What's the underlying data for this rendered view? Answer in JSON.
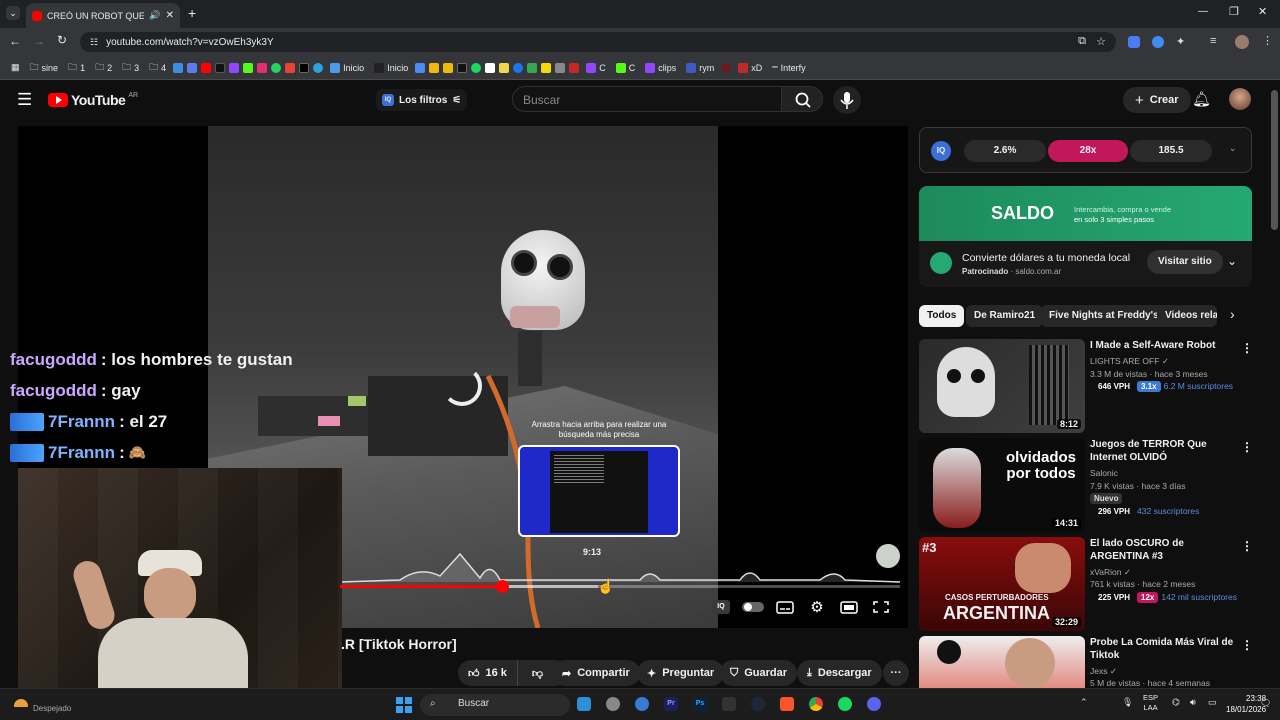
{
  "browser": {
    "tab_title": "CREÓ UN ROBOT QUE GAN",
    "url": "youtube.com/watch?v=vzOwEh3yk3Y",
    "bookmarks": [
      "sine",
      "1",
      "2",
      "3",
      "4",
      "Inicio",
      "Inicio",
      "C",
      "C",
      "clips",
      "rym",
      "xD",
      "Interfy"
    ]
  },
  "youtube": {
    "logo_text": "YouTube",
    "country": "AR",
    "filters_label": "Los filtros",
    "search_placeholder": "Buscar",
    "create_label": "Crear"
  },
  "player": {
    "chat": [
      {
        "user": "facugoddd",
        "msg": ": los hombres te gustan",
        "color": "#c9a8ff"
      },
      {
        "user": "facugoddd",
        "msg": ": gay",
        "color": "#c9a8ff"
      },
      {
        "user": "7Frannn",
        "msg": ": el 27",
        "color": "#7fb2ff"
      },
      {
        "user": "7Frannn",
        "msg": ":",
        "color": "#7fb2ff"
      }
    ],
    "seek_hint": "Arrastra hacia arriba para realizar una búsqueda más precisa",
    "preview_time": "9:13",
    "progress_fraction": 0.29,
    "scrub_fraction": 0.46
  },
  "video": {
    "title_fragment": ".R [Tiktok Horror]",
    "likes": "16 k",
    "share": "Compartir",
    "ask": "Preguntar",
    "save": "Guardar",
    "download": "Descargar"
  },
  "sidebar": {
    "iq_values": [
      "2.6%",
      "28x",
      "185.5"
    ],
    "ad_brand": "SALDO",
    "ad_tagline_1": "Intercambia, compra o vende",
    "ad_tagline_2": "en solo 3 simples pasos",
    "ad_title": "Convierte dólares a tu moneda local",
    "ad_sponsored": "Patrocinado",
    "ad_domain": "· saldo.com.ar",
    "ad_cta": "Visitar sitio",
    "chips": [
      "Todos",
      "De Ramiro21",
      "Five Nights at Freddy's",
      "Videos relac"
    ],
    "recs": [
      {
        "title": "I Made a Self-Aware Robot",
        "channel": "LIGHTS ARE OFF",
        "views": "3.3 M de vistas · hace 3 meses",
        "vph": "646 VPH",
        "mult": "3.1x",
        "subs": "6.2 M suscriptores",
        "duration": "8:12",
        "thumb_text": ""
      },
      {
        "title": "Juegos de TERROR Que Internet OLVIDÓ",
        "channel": "Salonic",
        "views": "7.9 K vistas · hace 3 días",
        "tag": "Nuevo",
        "vph": "296 VPH",
        "mult": "",
        "subs": "432 suscriptores",
        "duration": "14:31",
        "thumb_text": "olvidados por todos"
      },
      {
        "title": "El lado OSCURO de ARGENTINA #3",
        "channel": "xVaRion",
        "views": "761 k vistas · hace 2 meses",
        "vph": "225 VPH",
        "mult": "12x",
        "subs": "142 mil suscriptores",
        "duration": "32:29",
        "thumb_text": "ARGENTINA",
        "thumb_sub": "CASOS PERTURBADORES",
        "thumb_num": "#3"
      },
      {
        "title": "Probe La Comida Más Viral de Tiktok",
        "channel": "Jexs",
        "views": "5 M de vistas · hace 4 semanas",
        "vph": "",
        "mult": "",
        "subs": "",
        "duration": "",
        "thumb_text": ""
      }
    ]
  },
  "taskbar": {
    "weather": "Despejado",
    "search": "Buscar",
    "lang1": "ESP",
    "lang2": "LAA",
    "time": "23:38",
    "date": "18/01/2026"
  },
  "colors": {
    "red": "#ff0000",
    "saldo_green": "#25a873",
    "pink": "#c2185b"
  }
}
